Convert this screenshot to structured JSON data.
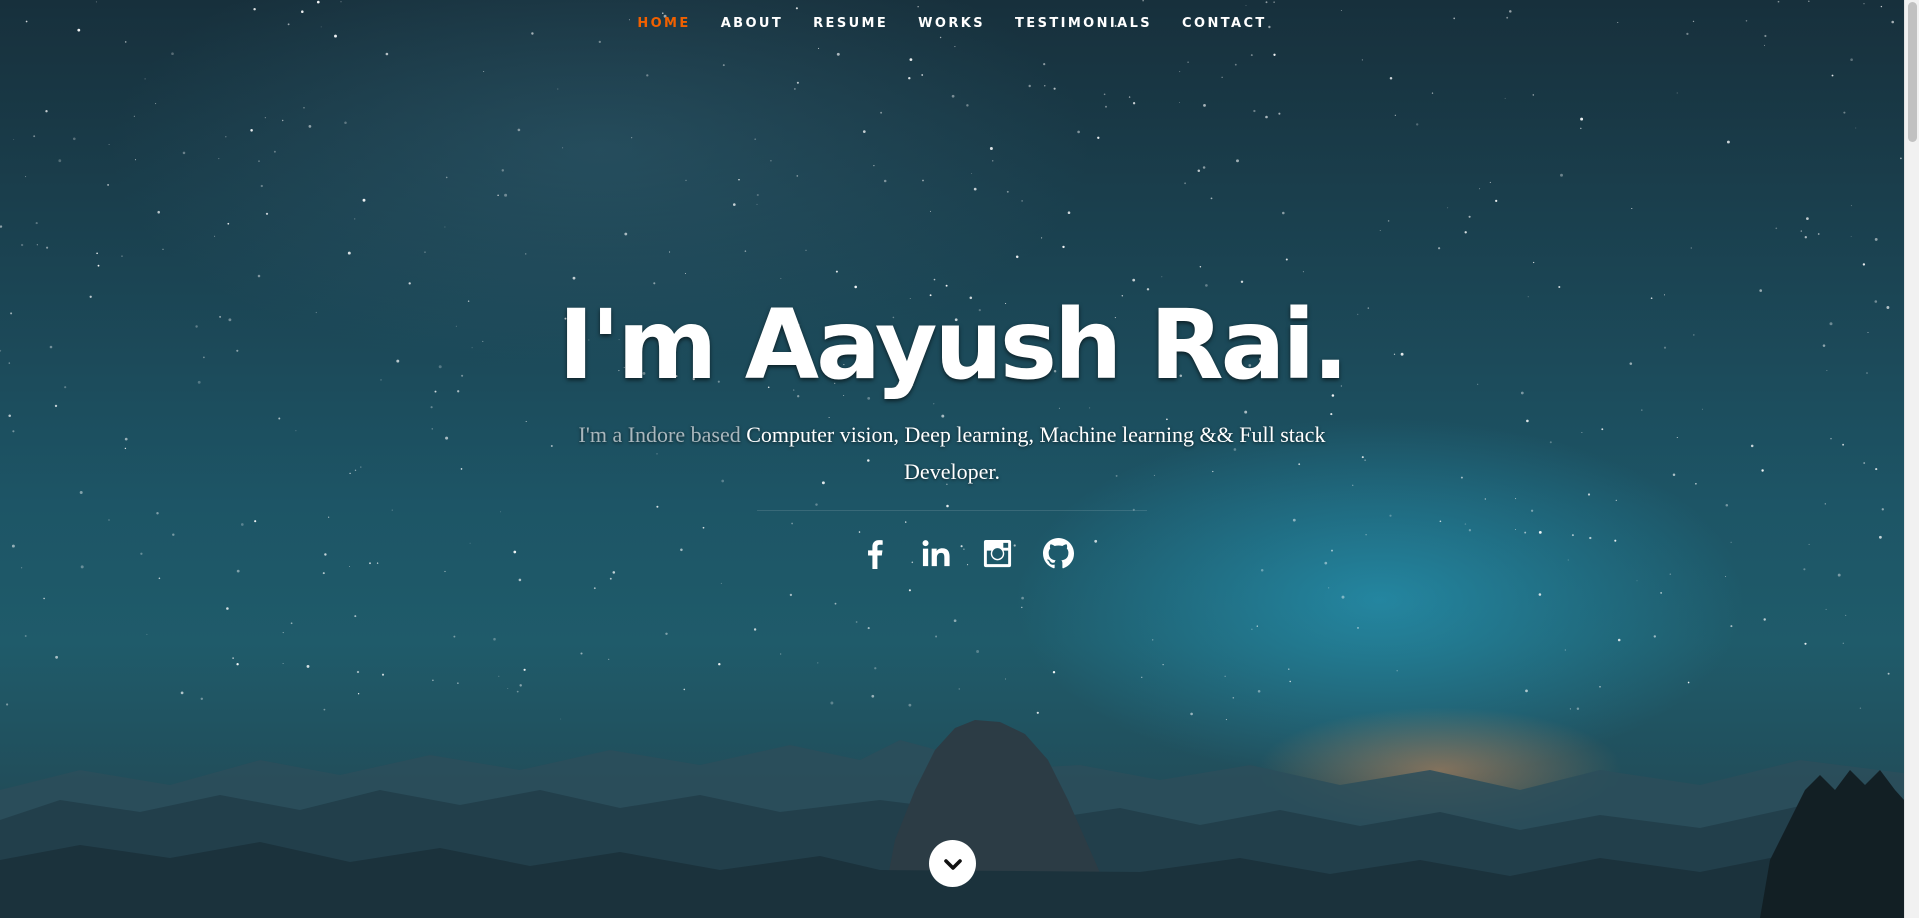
{
  "nav": {
    "items": [
      {
        "label": "HOME",
        "active": true
      },
      {
        "label": "ABOUT",
        "active": false
      },
      {
        "label": "RESUME",
        "active": false
      },
      {
        "label": "WORKS",
        "active": false
      },
      {
        "label": "TESTIMONIALS",
        "active": false
      },
      {
        "label": "CONTACT",
        "active": false
      }
    ],
    "active_color": "#F06000"
  },
  "banner": {
    "heading": "I'm Aayush Rai.",
    "tagline_prefix": "I'm a Indore based ",
    "tagline_highlight": "Computer vision, Deep learning, Machine learning && Full stack Developer",
    "tagline_suffix": "."
  },
  "social": [
    {
      "icon": "facebook-icon"
    },
    {
      "icon": "linkedin-icon"
    },
    {
      "icon": "instagram-icon"
    },
    {
      "icon": "github-icon"
    }
  ],
  "scroll_down": {
    "icon": "chevron-down-icon"
  }
}
